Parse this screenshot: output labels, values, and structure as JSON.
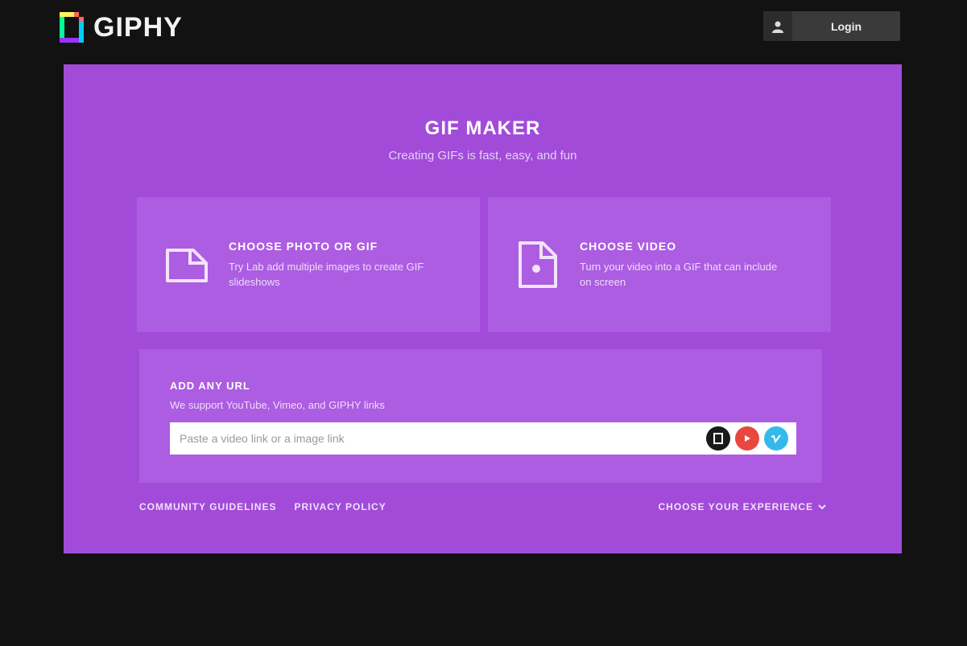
{
  "brand": {
    "name": "GIPHY"
  },
  "header": {
    "login_label": "Login"
  },
  "hero": {
    "title": "GIF MAKER",
    "subtitle": "Creating GIFs is fast, easy, and fun"
  },
  "options": [
    {
      "title": "CHOOSE PHOTO OR GIF",
      "desc": "Try Lab add multiple images to create GIF slideshows",
      "icon": "image-icon"
    },
    {
      "title": "CHOOSE VIDEO",
      "desc": "Turn your video into a GIF that can include on screen",
      "icon": "video-file-icon"
    }
  ],
  "url_section": {
    "title": "ADD ANY URL",
    "desc": "We support YouTube, Vimeo, and GIPHY links",
    "placeholder": "Paste a video link or a image link",
    "sources": [
      {
        "name": "giphy-source-icon",
        "color": "#1a1a1a"
      },
      {
        "name": "youtube-source-icon",
        "color": "#e8473f"
      },
      {
        "name": "vimeo-source-icon",
        "color": "#35b9ea"
      }
    ]
  },
  "footer": {
    "links": [
      "COMMUNITY GUIDELINES",
      "PRIVACY POLICY"
    ],
    "right_link": "CHOOSE YOUR EXPERIENCE"
  },
  "colors": {
    "panel": "#a24bd9",
    "card": "#ac5de1",
    "background": "#121212"
  }
}
